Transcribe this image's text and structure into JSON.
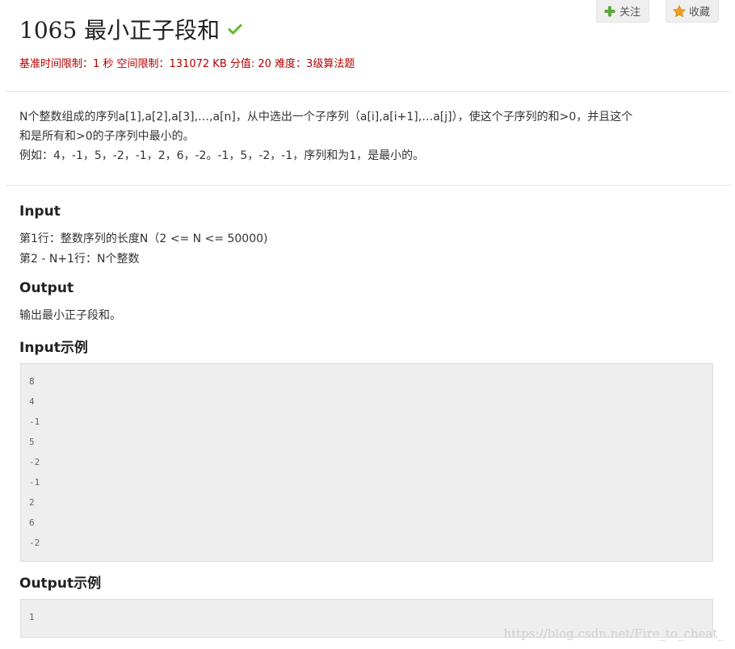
{
  "header": {
    "title": "1065 最小正子段和",
    "solved_icon": "check-icon",
    "limits": "基准时间限制：1 秒 空间限制：131072 KB 分值: 20 难度：3级算法题"
  },
  "actions": {
    "follow": {
      "label": "关注",
      "icon": "plus-icon"
    },
    "favorite": {
      "label": "收藏",
      "icon": "star-icon"
    }
  },
  "colors": {
    "limits_text": "#b30000",
    "check": "#5cb82f",
    "plus": "#5aa83a",
    "star": "#f0a020",
    "code_bg": "#eeeeee"
  },
  "description": {
    "line1": "N个整数组成的序列a[1],a[2],a[3],…,a[n]，从中选出一个子序列（a[i],a[i+1],…a[j]），使这个子序列的和>0，并且这个",
    "line2": "和是所有和>0的子序列中最小的。",
    "line3": "例如：4，-1，5，-2，-1，2，6，-2。-1，5，-2，-1，序列和为1，是最小的。"
  },
  "input_section": {
    "heading": "Input",
    "lines": [
      "第1行：整数序列的长度N（2 <= N <= 50000)",
      "第2 - N+1行：N个整数"
    ]
  },
  "output_section": {
    "heading": "Output",
    "lines": [
      "输出最小正子段和。"
    ]
  },
  "input_example": {
    "heading": "Input示例",
    "lines": [
      "8",
      "4",
      "-1",
      "5",
      "-2",
      "-1",
      "2",
      "6",
      "-2"
    ]
  },
  "output_example": {
    "heading": "Output示例",
    "lines": [
      "1"
    ]
  },
  "watermark": "https://blog.csdn.net/Fire_to_cheat_"
}
